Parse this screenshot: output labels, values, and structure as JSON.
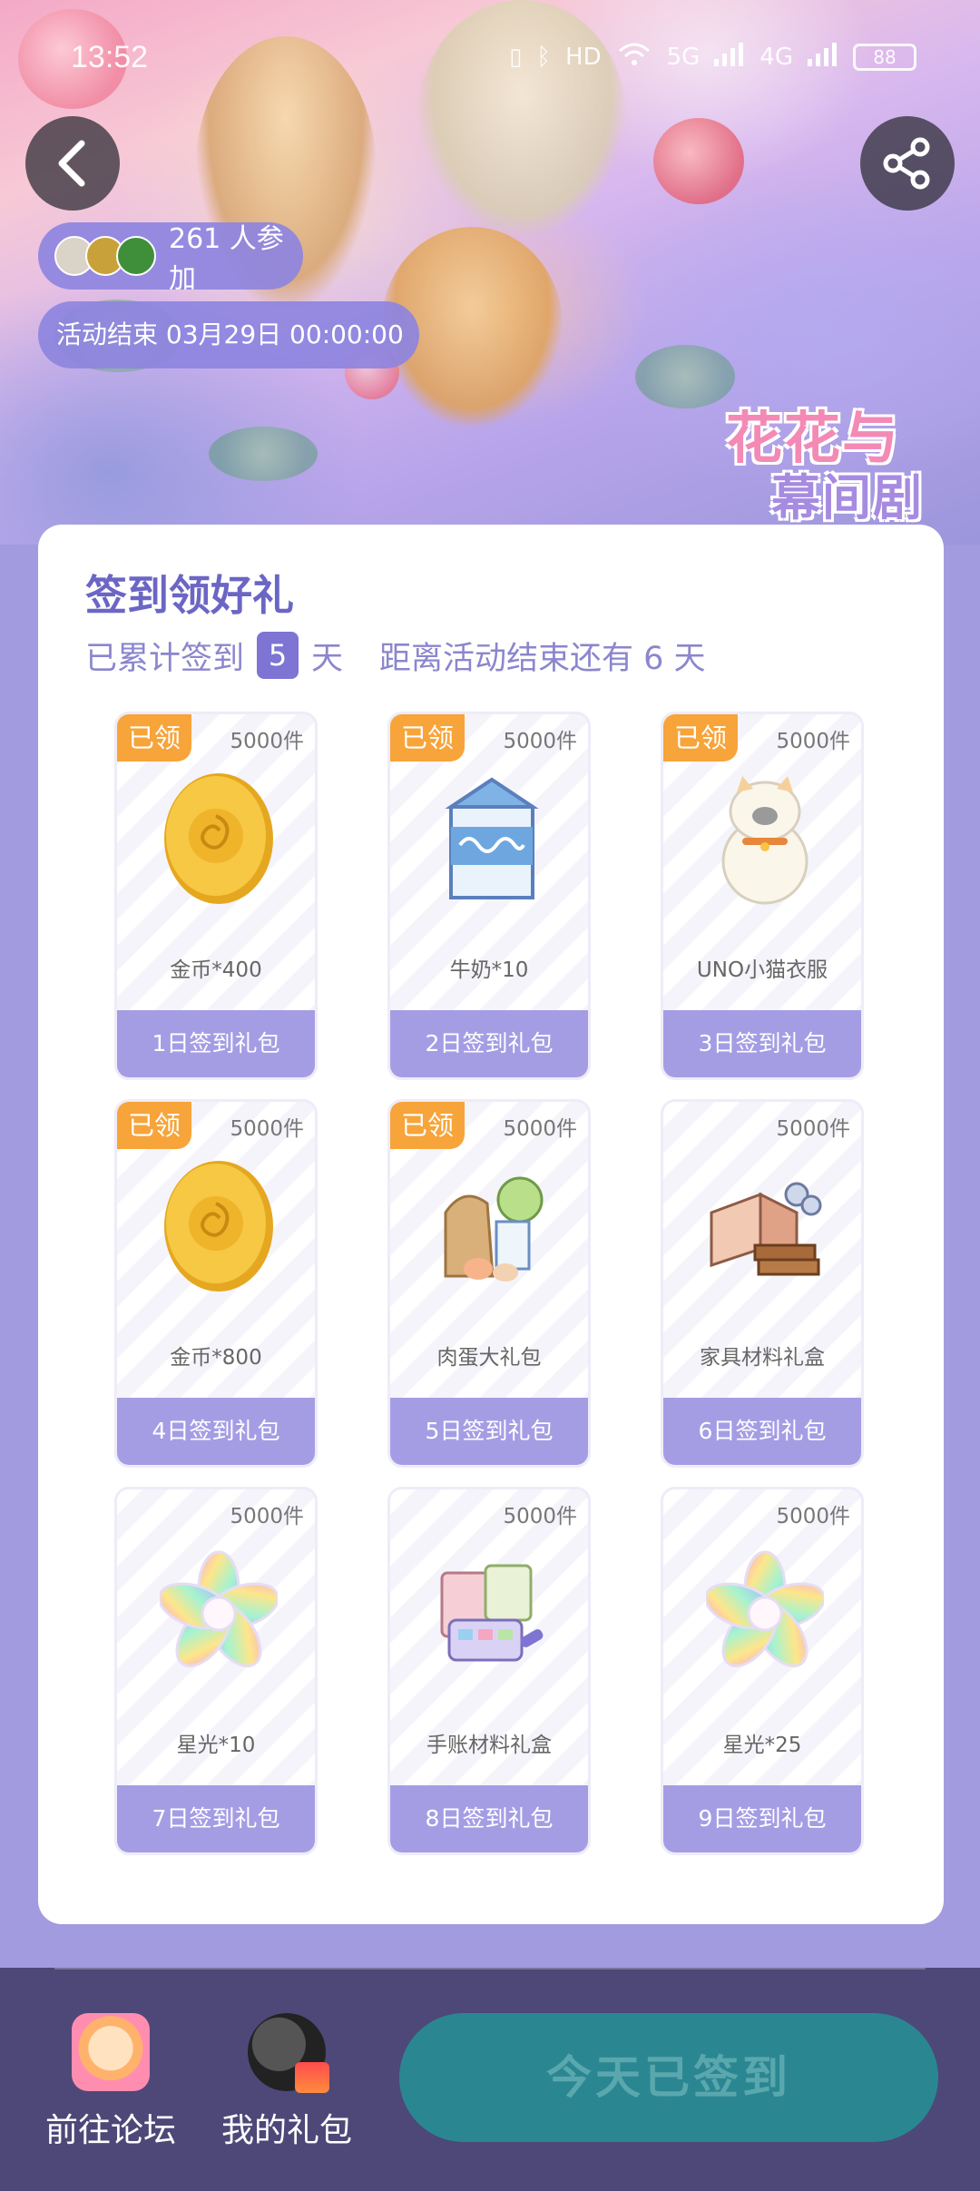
{
  "status_bar": {
    "time": "13:52",
    "network": "5G",
    "network2": "4G",
    "hd": "HD",
    "battery": "88"
  },
  "header": {
    "participants_text": "261 人参加",
    "end_time_text": "活动结束 03月29日 00:00:00",
    "title_art_line1": "花花与",
    "title_art_line2": "幕间剧"
  },
  "card": {
    "title": "签到领好礼",
    "sub_prefix": "已累计签到",
    "days_signed": "5",
    "sub_unit": "天",
    "sub_remaining": "距离活动结束还有 6 天"
  },
  "gifts": [
    {
      "claimed_label": "已领",
      "stock": "5000件",
      "name": "金币*400",
      "day_label": "1日签到礼包",
      "icon": "gold-coin-icon"
    },
    {
      "claimed_label": "已领",
      "stock": "5000件",
      "name": "牛奶*10",
      "day_label": "2日签到礼包",
      "icon": "milk-carton-icon"
    },
    {
      "claimed_label": "已领",
      "stock": "5000件",
      "name": "UNO小猫衣服",
      "day_label": "3日签到礼包",
      "icon": "cat-costume-icon"
    },
    {
      "claimed_label": "已领",
      "stock": "5000件",
      "name": "金币*800",
      "day_label": "4日签到礼包",
      "icon": "gold-coin-icon"
    },
    {
      "claimed_label": "已领",
      "stock": "5000件",
      "name": "肉蛋大礼包",
      "day_label": "5日签到礼包",
      "icon": "grocery-bag-icon"
    },
    {
      "claimed_label": "",
      "stock": "5000件",
      "name": "家具材料礼盒",
      "day_label": "6日签到礼包",
      "icon": "furniture-materials-icon"
    },
    {
      "claimed_label": "",
      "stock": "5000件",
      "name": "星光*10",
      "day_label": "7日签到礼包",
      "icon": "starlight-flower-icon"
    },
    {
      "claimed_label": "",
      "stock": "5000件",
      "name": "手账材料礼盒",
      "day_label": "8日签到礼包",
      "icon": "journal-kit-icon"
    },
    {
      "claimed_label": "",
      "stock": "5000件",
      "name": "星光*25",
      "day_label": "9日签到礼包",
      "icon": "starlight-flower-icon"
    }
  ],
  "bottom_bar": {
    "forum_label": "前往论坛",
    "gifts_label": "我的礼包",
    "signed_button_label": "今天已签到"
  },
  "colors": {
    "accent": "#7d74d4",
    "claimed_badge": "#f7a43a",
    "gift_footer": "#a59de4",
    "signed_button": "#2a8792",
    "bottom_bar": "#4d4878"
  }
}
